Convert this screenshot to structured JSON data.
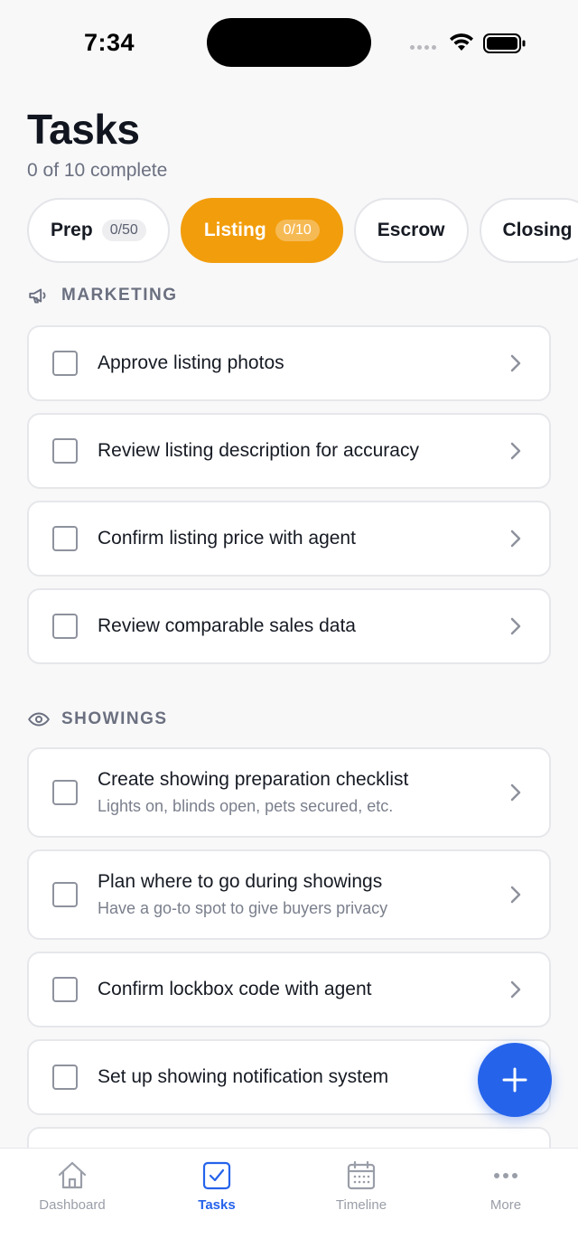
{
  "status_bar": {
    "time": "7:34"
  },
  "header": {
    "title": "Tasks",
    "subtitle": "0 of 10 complete"
  },
  "tabs": [
    {
      "label": "Prep",
      "count": "0/50",
      "active": false
    },
    {
      "label": "Listing",
      "count": "0/10",
      "active": true
    },
    {
      "label": "Escrow",
      "count": "",
      "active": false
    },
    {
      "label": "Closing",
      "count": "",
      "active": false
    }
  ],
  "sections": [
    {
      "label": "MARKETING",
      "icon": "megaphone-icon",
      "tasks": [
        {
          "title": "Approve listing photos",
          "subtitle": ""
        },
        {
          "title": "Review listing description for accuracy",
          "subtitle": ""
        },
        {
          "title": "Confirm listing price with agent",
          "subtitle": ""
        },
        {
          "title": "Review comparable sales data",
          "subtitle": ""
        }
      ]
    },
    {
      "label": "SHOWINGS",
      "icon": "eye-icon",
      "tasks": [
        {
          "title": "Create showing preparation checklist",
          "subtitle": "Lights on, blinds open, pets secured, etc."
        },
        {
          "title": "Plan where to go during showings",
          "subtitle": "Have a go-to spot to give buyers privacy"
        },
        {
          "title": "Confirm lockbox code with agent",
          "subtitle": ""
        },
        {
          "title": "Set up showing notification system",
          "subtitle": ""
        }
      ]
    }
  ],
  "bottom_nav": [
    {
      "label": "Dashboard",
      "icon": "home-icon",
      "active": false
    },
    {
      "label": "Tasks",
      "icon": "checkbox-icon",
      "active": true
    },
    {
      "label": "Timeline",
      "icon": "calendar-icon",
      "active": false
    },
    {
      "label": "More",
      "icon": "more-dots-icon",
      "active": false
    }
  ],
  "colors": {
    "accent_active_tab": "#f29d0c",
    "primary_blue": "#2563eb"
  }
}
